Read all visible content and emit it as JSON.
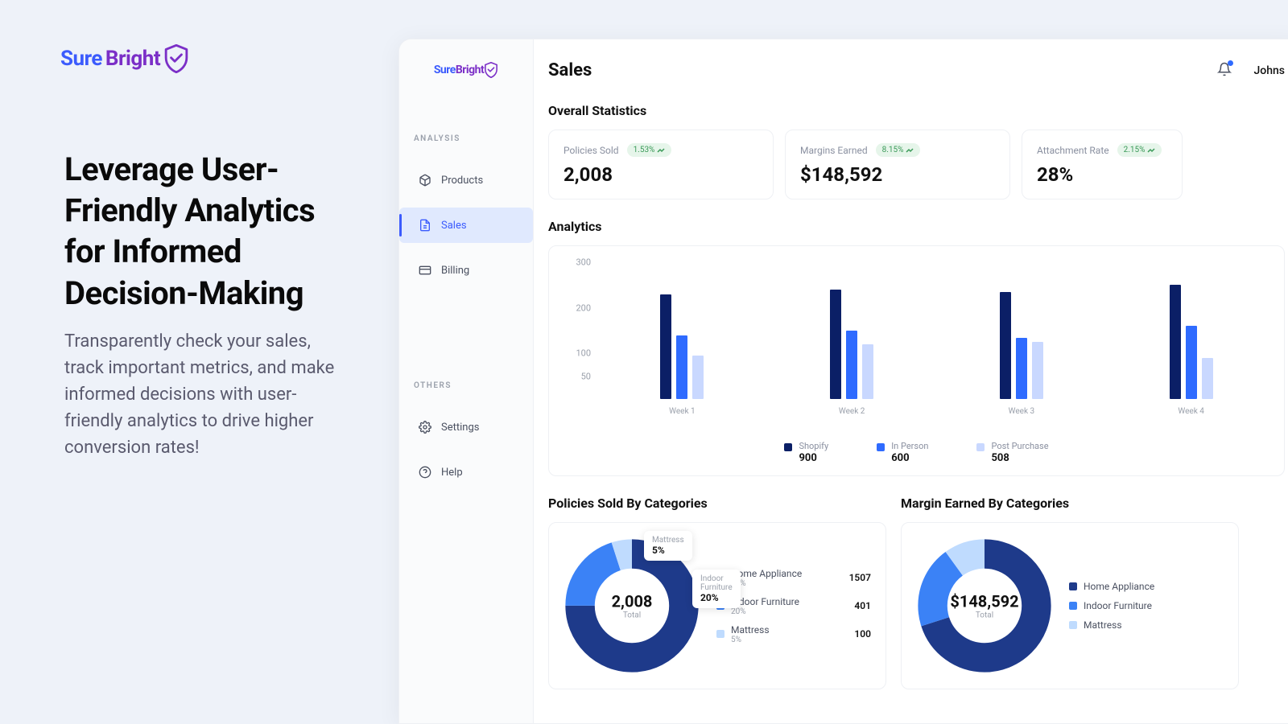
{
  "brand": {
    "sure": "Sure",
    "bright": "Bright"
  },
  "marketing": {
    "headline": "Leverage User-Friendly Analytics for Informed Decision-Making",
    "sub": "Transparently check your sales, track important metrics, and make informed decisions with user-friendly analytics to drive higher conversion rates!"
  },
  "sidebar": {
    "section_analysis": "ANALYSIS",
    "section_others": "OTHERS",
    "items": {
      "products": "Products",
      "sales": "Sales",
      "billing": "Billing",
      "settings": "Settings",
      "help": "Help"
    }
  },
  "header": {
    "page_title": "Sales",
    "user_name": "Johns"
  },
  "overall": {
    "title": "Overall Statistics",
    "policies": {
      "label": "Policies Sold",
      "trend": "1.53%",
      "value": "2,008"
    },
    "margins": {
      "label": "Margins Earned",
      "trend": "8.15%",
      "value": "$148,592"
    },
    "attachment": {
      "label": "Attachment Rate",
      "trend": "2.15%",
      "value": "28%"
    }
  },
  "analytics": {
    "title": "Analytics",
    "legend": {
      "shopify": {
        "name": "Shopify",
        "value": "900"
      },
      "inperson": {
        "name": "In Person",
        "value": "600"
      },
      "post": {
        "name": "Post Purchase",
        "value": "508"
      }
    }
  },
  "chart_data": {
    "type": "bar",
    "title": "Analytics",
    "ylabel": "",
    "ylim": [
      0,
      300
    ],
    "y_ticks": [
      50,
      100,
      200,
      300
    ],
    "categories": [
      "Week 1",
      "Week 2",
      "Week 3",
      "Week 4"
    ],
    "series": [
      {
        "name": "Shopify",
        "color": "#0b1f66",
        "values": [
          230,
          240,
          235,
          250
        ]
      },
      {
        "name": "In Person",
        "color": "#2f6bff",
        "values": [
          140,
          150,
          135,
          160
        ]
      },
      {
        "name": "Post Purchase",
        "color": "#c9d8ff",
        "values": [
          95,
          120,
          125,
          90
        ]
      }
    ],
    "legend_totals": {
      "Shopify": 900,
      "In Person": 600,
      "Post Purchase": 508
    }
  },
  "policies_by_cat": {
    "title": "Policies Sold By Categories",
    "total": "2,008",
    "total_label": "Total",
    "tooltip_mattress": {
      "label": "Mattress",
      "value": "5%"
    },
    "tooltip_indoor": {
      "label": "Indoor Furniture",
      "value": "20%"
    },
    "rows": [
      {
        "name": "Home Appliance",
        "pct": "75%",
        "value": "1507"
      },
      {
        "name": "Indoor Furniture",
        "pct": "20%",
        "value": "401"
      },
      {
        "name": "Mattress",
        "pct": "5%",
        "value": "100"
      }
    ],
    "donut": {
      "type": "pie",
      "slices": [
        {
          "name": "Home Appliance",
          "pct": 75,
          "color": "#1e3a8a"
        },
        {
          "name": "Indoor Furniture",
          "pct": 20,
          "color": "#3b82f6"
        },
        {
          "name": "Mattress",
          "pct": 5,
          "color": "#bfdbfe"
        }
      ]
    }
  },
  "margin_by_cat": {
    "title": "Margin Earned By Categories",
    "total": "$148,592",
    "total_label": "Total",
    "rows": [
      {
        "name": "Home Appliance"
      },
      {
        "name": "Indoor Furniture"
      },
      {
        "name": "Mattress"
      }
    ],
    "donut": {
      "type": "pie",
      "slices": [
        {
          "name": "Home Appliance",
          "pct": 70,
          "color": "#1e3a8a"
        },
        {
          "name": "Indoor Furniture",
          "pct": 20,
          "color": "#3b82f6"
        },
        {
          "name": "Mattress",
          "pct": 10,
          "color": "#bfdbfe"
        }
      ]
    }
  }
}
